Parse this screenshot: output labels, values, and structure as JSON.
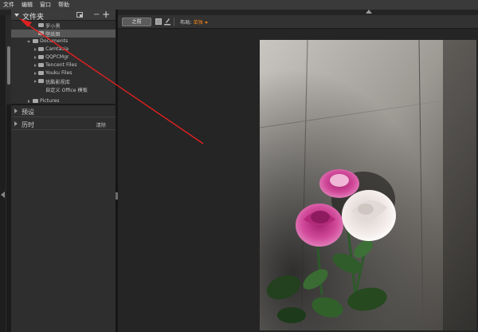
{
  "menu": [
    "文件",
    "编辑",
    "窗口",
    "帮助"
  ],
  "folders": {
    "title": "文件夹",
    "items": [
      {
        "label": "罗小黑",
        "level": 2,
        "selected": false
      },
      {
        "label": "壁纸图",
        "level": 2,
        "selected": true
      },
      {
        "label": "Documents",
        "level": 1,
        "selected": false
      },
      {
        "label": "Camtasia",
        "level": 2,
        "selected": false
      },
      {
        "label": "QQPCMgr",
        "level": 2,
        "selected": false
      },
      {
        "label": "Tencent Files",
        "level": 2,
        "selected": false
      },
      {
        "label": "Youku Files",
        "level": 2,
        "selected": false
      },
      {
        "label": "优酷影视库",
        "level": 2,
        "selected": false
      },
      {
        "label": "自定义 Office 模板",
        "level": 2,
        "selected": false
      },
      {
        "label": "Pictures",
        "level": 1,
        "selected": false
      }
    ]
  },
  "sections": {
    "presets": "预设",
    "history": "历时",
    "history_clear": "清除"
  },
  "toolbar": {
    "button": "之前",
    "layout_label": "布局:",
    "layout_value": "单独"
  },
  "colors": {
    "annotation_arrow": "#e02020",
    "layout_accent": "#e87e1b"
  }
}
